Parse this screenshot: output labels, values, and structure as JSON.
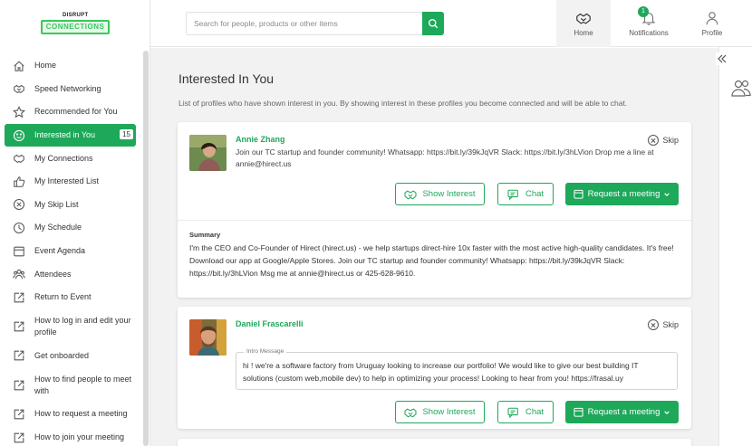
{
  "brand": {
    "top": "DISRUPT",
    "box": "CONNECTIONS"
  },
  "search": {
    "placeholder": "Search for people, products or other items"
  },
  "topnav": {
    "home": "Home",
    "notifications": "Notifications",
    "notifications_count": "1",
    "profile": "Profile"
  },
  "sidebar": {
    "items": [
      {
        "label": "Home"
      },
      {
        "label": "Speed Networking"
      },
      {
        "label": "Recommended for You"
      },
      {
        "label": "Interested in You",
        "count": "15"
      },
      {
        "label": "My Connections"
      },
      {
        "label": "My Interested List"
      },
      {
        "label": "My Skip List"
      },
      {
        "label": "My Schedule"
      },
      {
        "label": "Event Agenda"
      },
      {
        "label": "Attendees"
      },
      {
        "label": "Return to Event"
      },
      {
        "label": "How to log in and edit your profile"
      },
      {
        "label": "Get onboarded"
      },
      {
        "label": "How to find people to meet with"
      },
      {
        "label": "How to request a meeting"
      },
      {
        "label": "How to join your meeting"
      }
    ]
  },
  "main": {
    "title": "Interested In You",
    "description": "List of profiles who have shown interest in you. By showing interest in these profiles you become connected and will be able to chat."
  },
  "cards": [
    {
      "name": "Annie Zhang",
      "bio": "Join our TC startup and founder community! Whatsapp: https://bit.ly/39kJqVR Slack: https://bit.ly/3hLVion Drop me a line at annie@hirect.us",
      "skip": "Skip",
      "show_interest": "Show Interest",
      "chat": "Chat",
      "request": "Request a meeting",
      "summary_label": "Summary",
      "summary": "I'm the CEO and Co-Founder of Hirect (hirect.us) - we help startups direct-hire 10x faster with the most active high-quality candidates. It's free! Download our app at Google/Apple Stores. Join our TC startup and founder community! Whatsapp: https://bit.ly/39kJqVR Slack: https://bit.ly/3hLVion Msg me at annie@hirect.us or 425-628-9610."
    },
    {
      "name": "Daniel Frascarelli",
      "skip": "Skip",
      "intro_label": "Intro Message",
      "intro": "hi ! we're a software factory from Uruguay looking to increase our portfolio! We would like to give our best building IT solutions (custom web,mobile dev) to help in optimizing your process! Looking to hear from you! https://frasal.uy",
      "show_interest": "Show Interest",
      "chat": "Chat",
      "request": "Request a meeting"
    }
  ],
  "colors": {
    "accent": "#1ea85a",
    "background": "#f2f2f2"
  }
}
